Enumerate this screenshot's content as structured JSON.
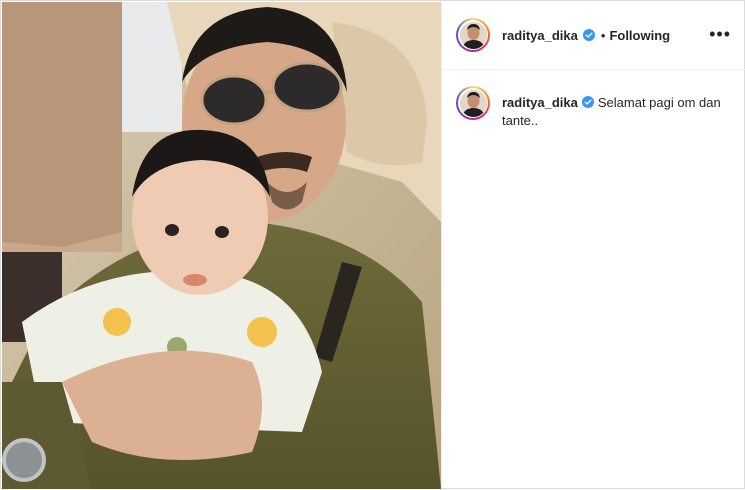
{
  "header": {
    "username": "raditya_dika",
    "separator": "•",
    "follow_status": "Following",
    "more_label": "•••"
  },
  "caption": {
    "username": "raditya_dika",
    "text": "Selamat pagi om dan tante.."
  },
  "icons": {
    "verified": "verified-badge-icon",
    "more": "more-options-icon"
  },
  "colors": {
    "verified_blue": "#3897f0",
    "border": "#dbdbdb",
    "text": "#262626"
  }
}
